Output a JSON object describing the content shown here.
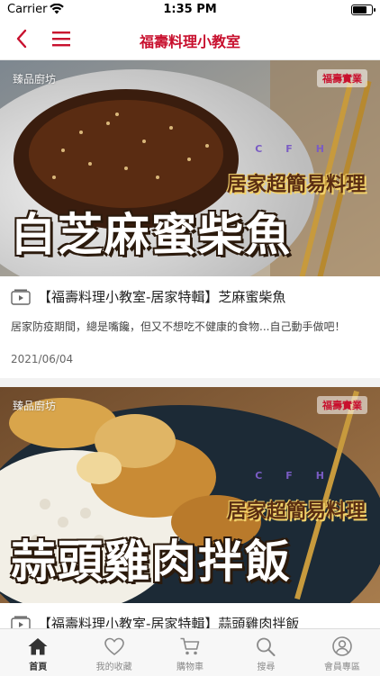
{
  "status_bar": {
    "carrier": "Carrier",
    "time": "1:35 PM",
    "battery_level": 0.9
  },
  "nav": {
    "title": "福壽料理小教室",
    "accent_color": "#c8102e",
    "back_icon": "chevron-left-icon",
    "menu_icon": "hamburger-menu-icon"
  },
  "articles": [
    {
      "thumb": {
        "logo": "臻品廚坊",
        "brand": "福壽實業",
        "cfh": "CFH",
        "subtitle": "居家超簡易料理",
        "headline": "白芝麻蜜柴魚"
      },
      "title": "【福壽料理小教室-居家特輯】芝麻蜜柴魚",
      "description": "居家防疫期間，總是嘴饞，但又不想吃不健康的食物...自己動手做吧！",
      "date": "2021/06/04"
    },
    {
      "thumb": {
        "logo": "臻品廚坊",
        "brand": "福壽實業",
        "cfh": "CFH",
        "subtitle": "居家超簡易料理",
        "headline": "蒜頭雞肉拌飯"
      },
      "title": "【福壽料理小教室-居家特輯】蒜頭雞肉拌飯",
      "description": "",
      "date": ""
    }
  ],
  "tabbar": [
    {
      "label": "首頁",
      "icon": "home-icon",
      "active": true
    },
    {
      "label": "我的收藏",
      "icon": "heart-icon",
      "active": false
    },
    {
      "label": "購物車",
      "icon": "cart-icon",
      "active": false
    },
    {
      "label": "搜尋",
      "icon": "search-icon",
      "active": false
    },
    {
      "label": "會員專區",
      "icon": "user-icon",
      "active": false
    }
  ]
}
